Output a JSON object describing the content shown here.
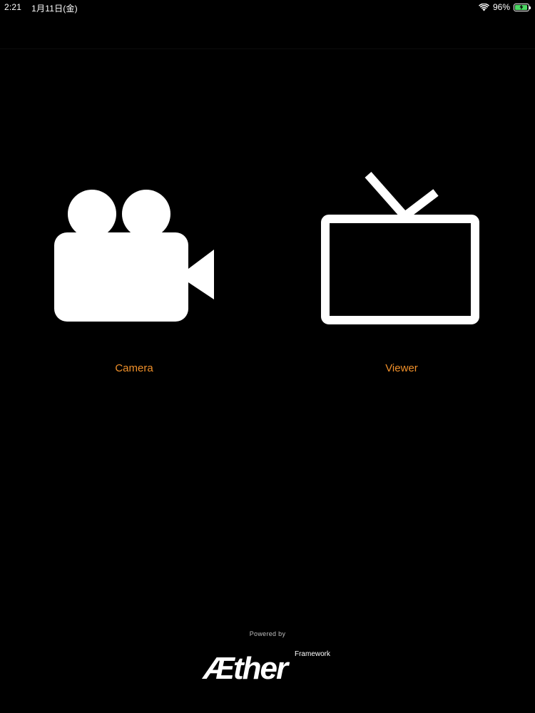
{
  "status_bar": {
    "time": "2:21",
    "date": "1月11日(金)",
    "battery": "96%",
    "battery_level": 0.96,
    "wifi_icon": "wifi-icon",
    "battery_icon": "battery-charging-icon"
  },
  "tiles": [
    {
      "label": "Camera",
      "icon": "video-camera-icon"
    },
    {
      "label": "Viewer",
      "icon": "television-icon"
    }
  ],
  "footer": {
    "powered_by": "Powered by",
    "logo_word": "Æther",
    "logo_sub": "Framework"
  },
  "colors": {
    "background": "#000000",
    "label_accent": "#f0902a",
    "icon": "#ffffff",
    "battery_fill": "#4cd964"
  }
}
